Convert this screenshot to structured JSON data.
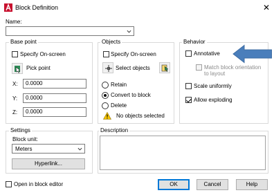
{
  "window": {
    "title": "Block Definition",
    "close_glyph": "✕",
    "app_icon": "autocad-icon"
  },
  "name": {
    "label": "Name:",
    "value": ""
  },
  "base_point": {
    "title": "Base point",
    "specify_label": "Specify On-screen",
    "pick_label": "Pick point",
    "x_label": "X:",
    "x_value": "0.0000",
    "y_label": "Y:",
    "y_value": "0.0000",
    "z_label": "Z:",
    "z_value": "0.0000"
  },
  "objects": {
    "title": "Objects",
    "specify_label": "Specify On-screen",
    "select_label": "Select objects",
    "retain_label": "Retain",
    "convert_label": "Convert to block",
    "delete_label": "Delete",
    "status": "No objects selected",
    "selected_option": "convert"
  },
  "behavior": {
    "title": "Behavior",
    "annotative_label": "Annotative",
    "match_label_1": "Match block orientation",
    "match_label_2": "to layout",
    "scale_label": "Scale uniformly",
    "exploding_label": "Allow exploding",
    "allow_exploding": true
  },
  "settings": {
    "title": "Settings",
    "unit_label": "Block unit:",
    "unit_value": "Meters",
    "hyperlink_label": "Hyperlink..."
  },
  "description": {
    "title": "Description",
    "value": ""
  },
  "footer": {
    "open_editor_label": "Open in block editor",
    "ok_label": "OK",
    "cancel_label": "Cancel",
    "help_label": "Help"
  },
  "colors": {
    "arrow": "#4a7ebb",
    "accent": "#0078d7"
  }
}
